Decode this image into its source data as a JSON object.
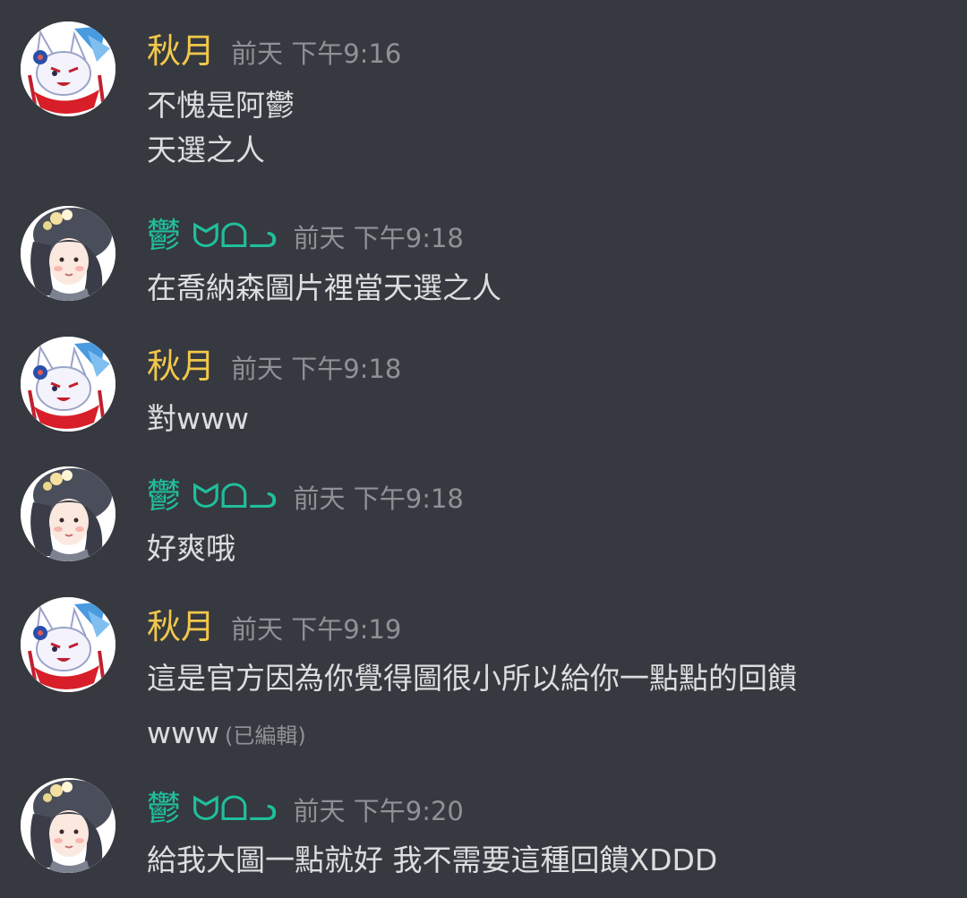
{
  "messages": [
    {
      "author": "秋月",
      "timestamp": "前天 下午9:16",
      "lines": [
        "不愧是阿鬱",
        "天選之人"
      ]
    },
    {
      "author": "鬱 ᗢᗝᓗ",
      "timestamp": "前天 下午9:18",
      "lines": [
        "在喬納森圖片裡當天選之人"
      ]
    },
    {
      "author": "秋月",
      "timestamp": "前天 下午9:18",
      "lines": [
        "對www"
      ]
    },
    {
      "author": "鬱 ᗢᗝᓗ",
      "timestamp": "前天 下午9:18",
      "lines": [
        "好爽哦"
      ]
    },
    {
      "author": "秋月",
      "timestamp": "前天 下午9:19",
      "lines": [
        "這是官方因為你覺得圖很小所以給你一點點的回饋",
        "www"
      ],
      "edited_label": "(已編輯)"
    },
    {
      "author": "鬱 ᗢᗝᓗ",
      "timestamp": "前天 下午9:20",
      "lines": [
        "給我大圖一點就好 我不需要這種回饋XDDD"
      ]
    }
  ],
  "colors": {
    "background": "#36393f",
    "author_autumn": "#f2c84b",
    "author_yu": "#1fbf9c",
    "timestamp": "#8e9297",
    "message_text": "#dcddde"
  },
  "icons": {
    "autumn_avatar": "fox-mask-avatar",
    "yu_avatar": "curly-hair-girl-avatar"
  }
}
